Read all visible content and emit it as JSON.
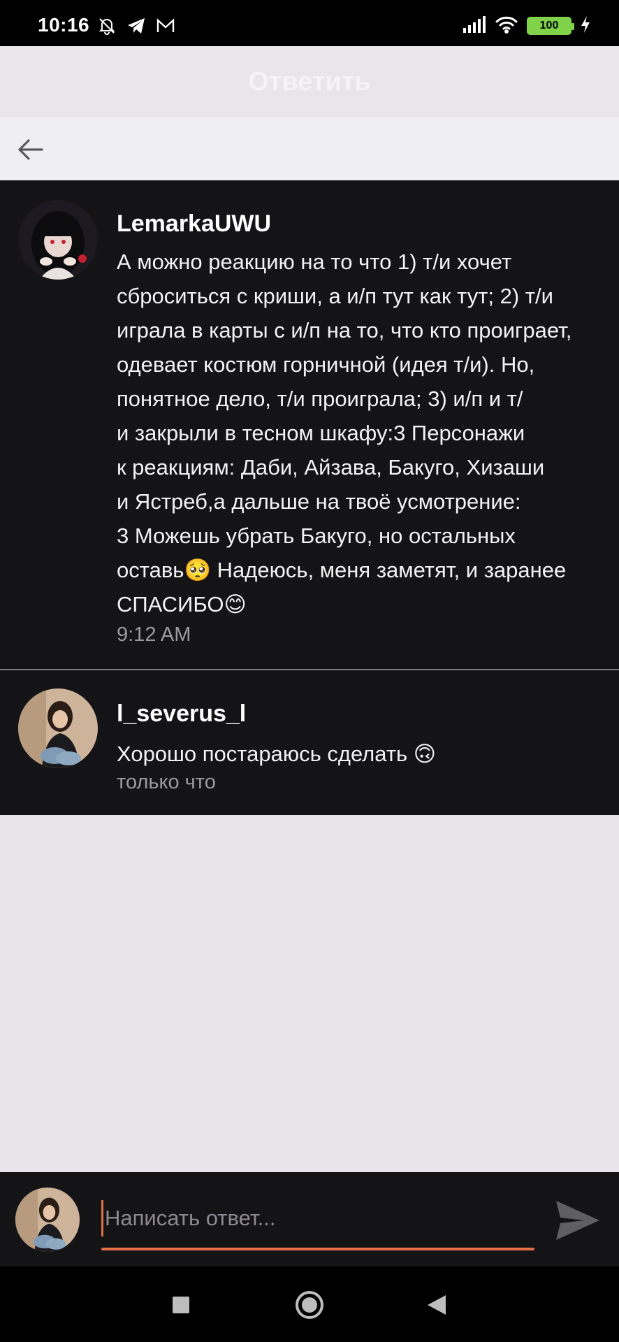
{
  "status_bar": {
    "time": "10:16",
    "battery": "100",
    "icons": [
      "bell-off-icon",
      "telegram-icon",
      "mail-icon",
      "signal-icon",
      "wifi-icon",
      "battery-icon",
      "charging-icon"
    ]
  },
  "header": {
    "title": "Ответить",
    "back_icon": "arrow-left-icon"
  },
  "comments": [
    {
      "username": "LemarkaUWU",
      "text": "А можно реакцию на то что 1) т/и хочет\nсброситься с криши, а и/п тут как тут; 2) т/и\nиграла в карты с и/п на то, что кто проиграет,\nодевает костюм горничной (идея т/и). Но,\nпонятное дело, т/и проиграла; 3) и/п и т/\nи закрыли в тесном шкафу:3 Персонажи\nк реакциям: Даби, Айзава, Бакуго, Хизаши\nи Ястреб,а дальше на твоё усмотрение:\n3 Можешь убрать Бакуго, но остальных\nоставь🥺 Надеюсь, меня заметят, и заранее\nСПАСИБО😊",
      "time": "9:12 AM"
    },
    {
      "username": "l_severus_l",
      "text": "Хорошо постараюсь сделать 🙃",
      "time": "только что"
    }
  ],
  "reply": {
    "placeholder": "Написать ответ...",
    "send_icon": "send-icon"
  },
  "nav": {
    "icons": [
      "recent-apps-icon",
      "home-icon",
      "back-icon"
    ]
  },
  "colors": {
    "accent": "#e46f45",
    "card_bg": "#141316",
    "page_bg": "#e7e5ea"
  }
}
